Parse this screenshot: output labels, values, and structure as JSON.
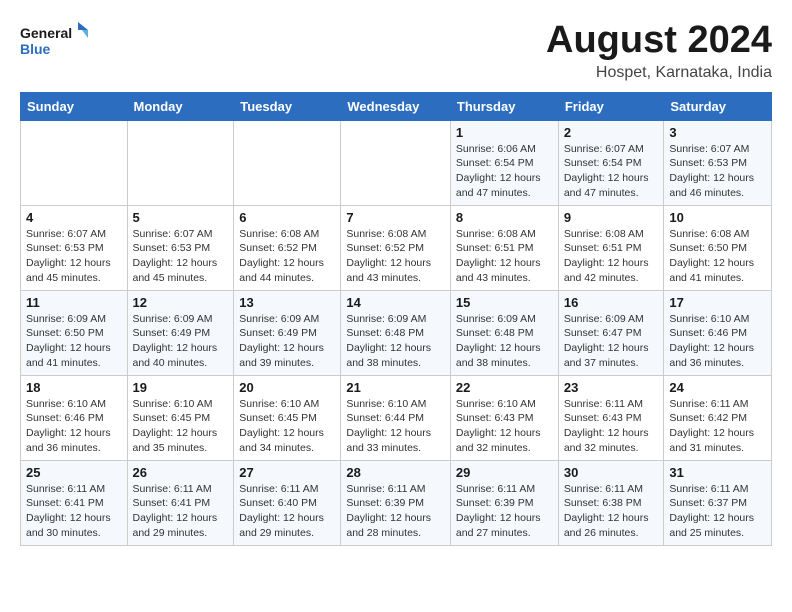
{
  "header": {
    "logo_line1": "General",
    "logo_line2": "Blue",
    "title": "August 2024",
    "location": "Hospet, Karnataka, India"
  },
  "weekdays": [
    "Sunday",
    "Monday",
    "Tuesday",
    "Wednesday",
    "Thursday",
    "Friday",
    "Saturday"
  ],
  "weeks": [
    [
      {
        "day": "",
        "detail": ""
      },
      {
        "day": "",
        "detail": ""
      },
      {
        "day": "",
        "detail": ""
      },
      {
        "day": "",
        "detail": ""
      },
      {
        "day": "1",
        "detail": "Sunrise: 6:06 AM\nSunset: 6:54 PM\nDaylight: 12 hours and 47 minutes."
      },
      {
        "day": "2",
        "detail": "Sunrise: 6:07 AM\nSunset: 6:54 PM\nDaylight: 12 hours and 47 minutes."
      },
      {
        "day": "3",
        "detail": "Sunrise: 6:07 AM\nSunset: 6:53 PM\nDaylight: 12 hours and 46 minutes."
      }
    ],
    [
      {
        "day": "4",
        "detail": "Sunrise: 6:07 AM\nSunset: 6:53 PM\nDaylight: 12 hours and 45 minutes."
      },
      {
        "day": "5",
        "detail": "Sunrise: 6:07 AM\nSunset: 6:53 PM\nDaylight: 12 hours and 45 minutes."
      },
      {
        "day": "6",
        "detail": "Sunrise: 6:08 AM\nSunset: 6:52 PM\nDaylight: 12 hours and 44 minutes."
      },
      {
        "day": "7",
        "detail": "Sunrise: 6:08 AM\nSunset: 6:52 PM\nDaylight: 12 hours and 43 minutes."
      },
      {
        "day": "8",
        "detail": "Sunrise: 6:08 AM\nSunset: 6:51 PM\nDaylight: 12 hours and 43 minutes."
      },
      {
        "day": "9",
        "detail": "Sunrise: 6:08 AM\nSunset: 6:51 PM\nDaylight: 12 hours and 42 minutes."
      },
      {
        "day": "10",
        "detail": "Sunrise: 6:08 AM\nSunset: 6:50 PM\nDaylight: 12 hours and 41 minutes."
      }
    ],
    [
      {
        "day": "11",
        "detail": "Sunrise: 6:09 AM\nSunset: 6:50 PM\nDaylight: 12 hours and 41 minutes."
      },
      {
        "day": "12",
        "detail": "Sunrise: 6:09 AM\nSunset: 6:49 PM\nDaylight: 12 hours and 40 minutes."
      },
      {
        "day": "13",
        "detail": "Sunrise: 6:09 AM\nSunset: 6:49 PM\nDaylight: 12 hours and 39 minutes."
      },
      {
        "day": "14",
        "detail": "Sunrise: 6:09 AM\nSunset: 6:48 PM\nDaylight: 12 hours and 38 minutes."
      },
      {
        "day": "15",
        "detail": "Sunrise: 6:09 AM\nSunset: 6:48 PM\nDaylight: 12 hours and 38 minutes."
      },
      {
        "day": "16",
        "detail": "Sunrise: 6:09 AM\nSunset: 6:47 PM\nDaylight: 12 hours and 37 minutes."
      },
      {
        "day": "17",
        "detail": "Sunrise: 6:10 AM\nSunset: 6:46 PM\nDaylight: 12 hours and 36 minutes."
      }
    ],
    [
      {
        "day": "18",
        "detail": "Sunrise: 6:10 AM\nSunset: 6:46 PM\nDaylight: 12 hours and 36 minutes."
      },
      {
        "day": "19",
        "detail": "Sunrise: 6:10 AM\nSunset: 6:45 PM\nDaylight: 12 hours and 35 minutes."
      },
      {
        "day": "20",
        "detail": "Sunrise: 6:10 AM\nSunset: 6:45 PM\nDaylight: 12 hours and 34 minutes."
      },
      {
        "day": "21",
        "detail": "Sunrise: 6:10 AM\nSunset: 6:44 PM\nDaylight: 12 hours and 33 minutes."
      },
      {
        "day": "22",
        "detail": "Sunrise: 6:10 AM\nSunset: 6:43 PM\nDaylight: 12 hours and 32 minutes."
      },
      {
        "day": "23",
        "detail": "Sunrise: 6:11 AM\nSunset: 6:43 PM\nDaylight: 12 hours and 32 minutes."
      },
      {
        "day": "24",
        "detail": "Sunrise: 6:11 AM\nSunset: 6:42 PM\nDaylight: 12 hours and 31 minutes."
      }
    ],
    [
      {
        "day": "25",
        "detail": "Sunrise: 6:11 AM\nSunset: 6:41 PM\nDaylight: 12 hours and 30 minutes."
      },
      {
        "day": "26",
        "detail": "Sunrise: 6:11 AM\nSunset: 6:41 PM\nDaylight: 12 hours and 29 minutes."
      },
      {
        "day": "27",
        "detail": "Sunrise: 6:11 AM\nSunset: 6:40 PM\nDaylight: 12 hours and 29 minutes."
      },
      {
        "day": "28",
        "detail": "Sunrise: 6:11 AM\nSunset: 6:39 PM\nDaylight: 12 hours and 28 minutes."
      },
      {
        "day": "29",
        "detail": "Sunrise: 6:11 AM\nSunset: 6:39 PM\nDaylight: 12 hours and 27 minutes."
      },
      {
        "day": "30",
        "detail": "Sunrise: 6:11 AM\nSunset: 6:38 PM\nDaylight: 12 hours and 26 minutes."
      },
      {
        "day": "31",
        "detail": "Sunrise: 6:11 AM\nSunset: 6:37 PM\nDaylight: 12 hours and 25 minutes."
      }
    ]
  ]
}
